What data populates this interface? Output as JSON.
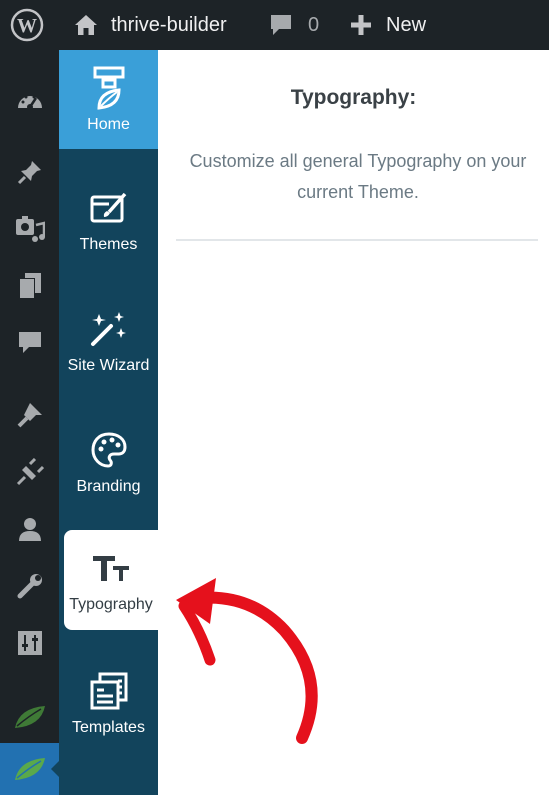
{
  "adminbar": {
    "site_name": "thrive-builder",
    "comment_count": "0",
    "new_label": "New"
  },
  "wp_menu": {
    "items": [
      {
        "icon": "dashboard-icon"
      },
      {
        "icon": "pin-icon"
      },
      {
        "icon": "media-icon"
      },
      {
        "icon": "pages-icon"
      },
      {
        "icon": "comments-icon"
      },
      {
        "icon": "appearance-icon"
      },
      {
        "icon": "plugins-icon"
      },
      {
        "icon": "users-icon"
      },
      {
        "icon": "tools-icon"
      },
      {
        "icon": "settings-icon"
      },
      {
        "icon": "leaf-icon"
      },
      {
        "icon": "leaf-icon",
        "active": true
      }
    ]
  },
  "thrive_sidebar": {
    "home": "Home",
    "themes": "Themes",
    "site_wizard": "Site Wizard",
    "branding": "Branding",
    "typography": "Typography",
    "templates": "Templates"
  },
  "main": {
    "title": "Typography:",
    "description": "Customize all general Typography on your current Theme."
  },
  "colors": {
    "adminbar_bg": "#1d2327",
    "sidebar_bg": "#12445c",
    "home_bg": "#3a9fd8",
    "annotation_arrow": "#e5111c"
  }
}
